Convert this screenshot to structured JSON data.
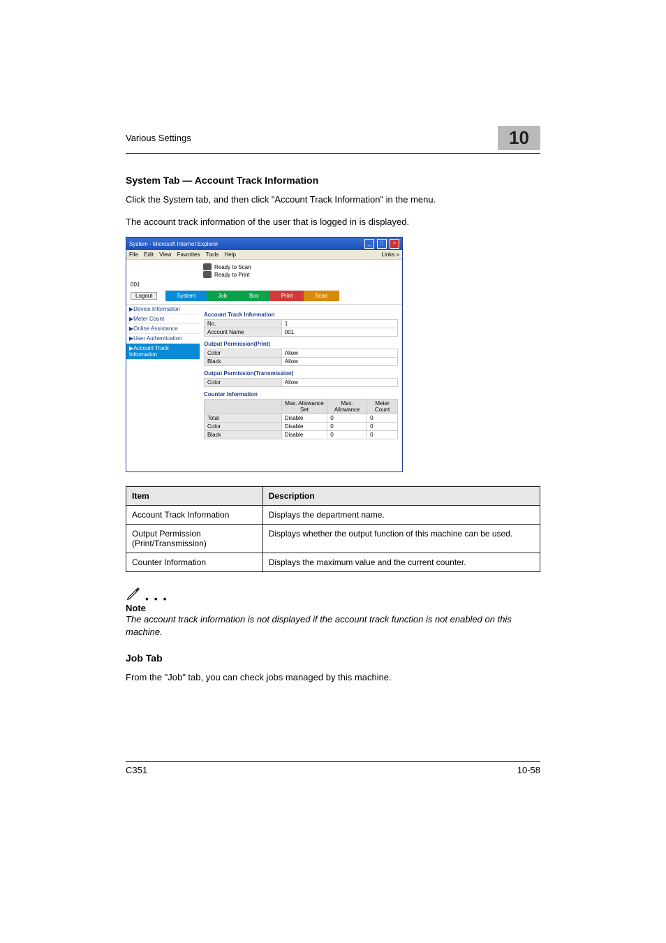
{
  "header": {
    "section": "Various Settings",
    "chapter": "10"
  },
  "h1": "System Tab — Account Track Information",
  "p1": "Click the System tab, and then click \"Account Track Information\" in the menu.",
  "p2": "The account track information of the user that is logged in is displayed.",
  "screenshot": {
    "title": "System - Microsoft Internet Explorer",
    "menubar": {
      "file": "File",
      "edit": "Edit",
      "view": "View",
      "fav": "Favorites",
      "tools": "Tools",
      "help": "Help",
      "links": "Links"
    },
    "status": {
      "s1": "Ready to Scan",
      "s2": "Ready to Print"
    },
    "user": "001",
    "logout": "Logout",
    "tabs": {
      "system": "System",
      "job": "Job",
      "box": "Box",
      "print": "Print",
      "scan": "Scan"
    },
    "side": {
      "devinfo": "▶Device Information",
      "meter": "▶Meter Count",
      "online": "▶Online Assistance",
      "userauth": "▶User Authentication",
      "acct": "▶Account Track Information"
    },
    "pane": {
      "h_acct": "Account Track Information",
      "no_l": "No.",
      "no_v": "1",
      "name_l": "Account Name",
      "name_v": "001",
      "h_opp": "Output Permission(Print)",
      "opp_color_l": "Color",
      "opp_color_v": "Allow",
      "opp_black_l": "Black",
      "opp_black_v": "Allow",
      "h_opt": "Output Permission(Transmission)",
      "opt_color_l": "Color",
      "opt_color_v": "Allow",
      "h_ci": "Counter Information",
      "ci_h1": "",
      "ci_h2": "Max. Allowance Set",
      "ci_h3": "Max. Allowance",
      "ci_h4": "Meter Count",
      "ci_r1_l": "Total",
      "ci_r1_a": "Disable",
      "ci_r1_b": "0",
      "ci_r1_c": "0",
      "ci_r2_l": "Color",
      "ci_r2_a": "Disable",
      "ci_r2_b": "0",
      "ci_r2_c": "0",
      "ci_r3_l": "Black",
      "ci_r3_a": "Disable",
      "ci_r3_b": "0",
      "ci_r3_c": "0"
    }
  },
  "table": {
    "h_item": "Item",
    "h_desc": "Description",
    "r1_item": "Account Track Information",
    "r1_desc": "Displays the department name.",
    "r2_item": "Output Permission (Print/Transmission)",
    "r2_desc": "Displays whether the output function of this machine can be used.",
    "r3_item": "Counter Information",
    "r3_desc": "Displays the maximum value and the current counter."
  },
  "note": {
    "label": "Note",
    "text": "The account track information is not displayed if the account track function is not enabled on this machine."
  },
  "h2": "Job Tab",
  "p3": "From the \"Job\" tab, you can check jobs managed by this machine.",
  "footer": {
    "model": "C351",
    "pageno": "10-58"
  }
}
